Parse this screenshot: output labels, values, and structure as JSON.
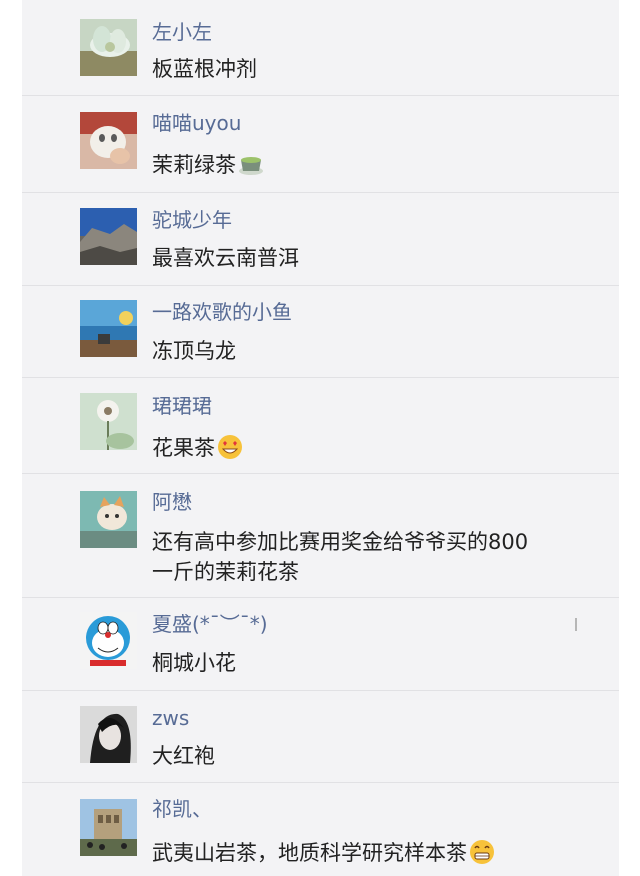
{
  "comments": [
    {
      "name": "左小左",
      "text": "板蓝根冲剂",
      "avatar": "lotus-photo"
    },
    {
      "name": "喵喵uyou",
      "text": "茉莉绿茶",
      "avatar": "cat-photo",
      "emoji": "green-tea-emoji"
    },
    {
      "name": "驼城少年",
      "text": "最喜欢云南普洱",
      "avatar": "cliff-photo"
    },
    {
      "name": "一路欢歌的小鱼",
      "text": "冻顶乌龙",
      "avatar": "beach-photo"
    },
    {
      "name": "珺珺珺",
      "text": "花果茶",
      "avatar": "dandelion-photo",
      "emoji": "heart-eyes-emoji"
    },
    {
      "name": "阿懋",
      "text": "还有高中参加比赛用奖金给爷爷买的800一斤的茉莉花茶",
      "avatar": "kitten-photo"
    },
    {
      "name": "夏盛(*ˉ︶ˉ*)",
      "text": "桐城小花",
      "avatar": "doraemon-avatar"
    },
    {
      "name": "zws",
      "text": "大红袍",
      "avatar": "portrait-photo"
    },
    {
      "name": "祁凯、",
      "text": "武夷山岩茶，地质科学研究样本茶",
      "avatar": "ruins-photo",
      "emoji": "grin-emoji"
    }
  ]
}
